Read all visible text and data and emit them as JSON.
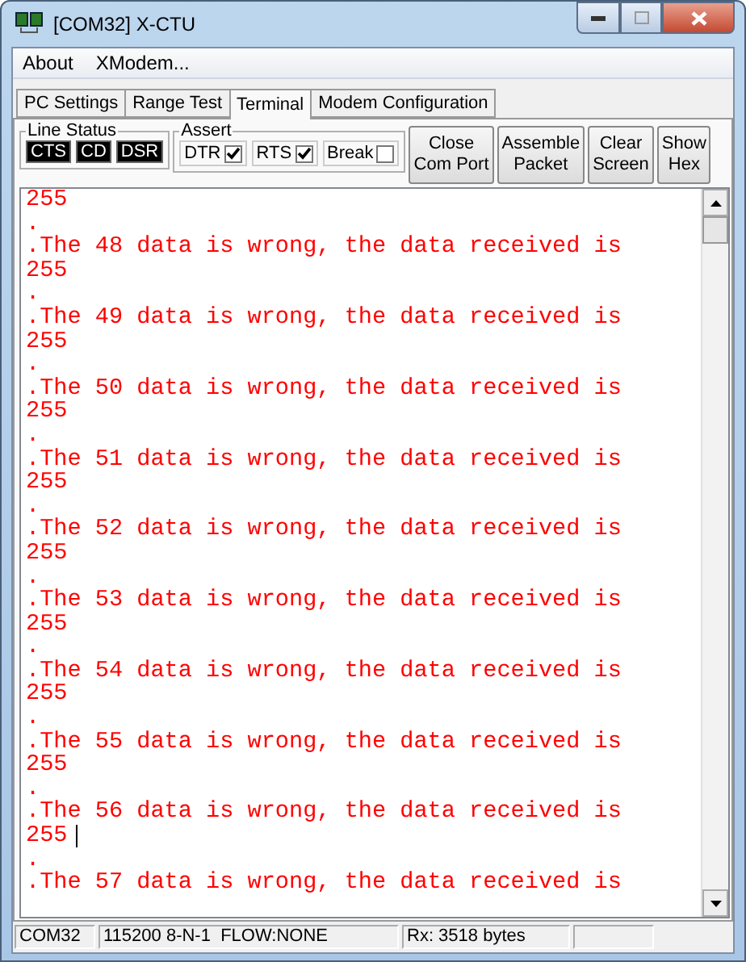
{
  "window": {
    "title": "[COM32] X-CTU"
  },
  "menu": [
    "About",
    "XModem..."
  ],
  "tabs": [
    {
      "label": "PC Settings",
      "selected": false
    },
    {
      "label": "Range Test",
      "selected": false
    },
    {
      "label": "Terminal",
      "selected": true
    },
    {
      "label": "Modem Configuration",
      "selected": false
    }
  ],
  "line_status": {
    "title": "Line Status",
    "indicators": [
      {
        "label": "CTS",
        "on": true
      },
      {
        "label": "CD",
        "on": true
      },
      {
        "label": "DSR",
        "on": true
      }
    ]
  },
  "assert": {
    "title": "Assert",
    "options": [
      {
        "label": "DTR",
        "checked": true
      },
      {
        "label": "RTS",
        "checked": true
      },
      {
        "label": "Break",
        "checked": false
      }
    ]
  },
  "buttons": [
    "Close\nCom Port",
    "Assemble\nPacket",
    "Clear\nScreen",
    "Show\nHex"
  ],
  "terminal": {
    "lines": [
      {
        "text": "255",
        "cursor": false
      },
      {
        "text": ".",
        "cursor": false
      },
      {
        "text": ".The 48 data is wrong, the data received is",
        "cursor": false
      },
      {
        "text": "255",
        "cursor": false
      },
      {
        "text": ".",
        "cursor": false
      },
      {
        "text": ".The 49 data is wrong, the data received is",
        "cursor": false
      },
      {
        "text": "255",
        "cursor": false
      },
      {
        "text": ".",
        "cursor": false
      },
      {
        "text": ".The 50 data is wrong, the data received is",
        "cursor": false
      },
      {
        "text": "255",
        "cursor": false
      },
      {
        "text": ".",
        "cursor": false
      },
      {
        "text": ".The 51 data is wrong, the data received is",
        "cursor": false
      },
      {
        "text": "255",
        "cursor": false
      },
      {
        "text": ".",
        "cursor": false
      },
      {
        "text": ".The 52 data is wrong, the data received is",
        "cursor": false
      },
      {
        "text": "255",
        "cursor": false
      },
      {
        "text": ".",
        "cursor": false
      },
      {
        "text": ".The 53 data is wrong, the data received is",
        "cursor": false
      },
      {
        "text": "255",
        "cursor": false
      },
      {
        "text": ".",
        "cursor": false
      },
      {
        "text": ".The 54 data is wrong, the data received is",
        "cursor": false
      },
      {
        "text": "255",
        "cursor": false
      },
      {
        "text": ".",
        "cursor": false
      },
      {
        "text": ".The 55 data is wrong, the data received is",
        "cursor": false
      },
      {
        "text": "255",
        "cursor": false
      },
      {
        "text": ".",
        "cursor": false
      },
      {
        "text": ".The 56 data is wrong, the data received is",
        "cursor": false
      },
      {
        "text": "255",
        "cursor": true
      },
      {
        "text": ".",
        "cursor": false
      },
      {
        "text": ".The 57 data is wrong, the data received is",
        "cursor": false
      }
    ]
  },
  "status_bar": [
    "COM32",
    "115200 8-N-1  FLOW:NONE",
    "Rx: 3518 bytes"
  ]
}
